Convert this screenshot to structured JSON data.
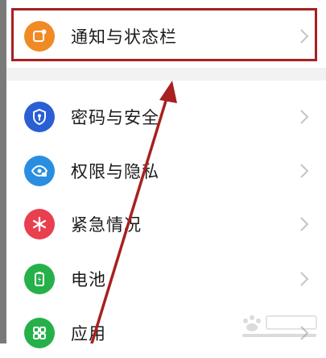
{
  "settings": {
    "items": [
      {
        "label": "通知与状态栏",
        "icon": "notification-icon",
        "icon_color": "#f08a24"
      },
      {
        "label": "密码与安全",
        "icon": "shield-key-icon",
        "icon_color": "#2a5fd6"
      },
      {
        "label": "权限与隐私",
        "icon": "eye-lock-icon",
        "icon_color": "#2a8ee0"
      },
      {
        "label": "紧急情况",
        "icon": "emergency-icon",
        "icon_color": "#e8404f"
      },
      {
        "label": "电池",
        "icon": "battery-icon",
        "icon_color": "#26b04a"
      },
      {
        "label": "应用",
        "icon": "apps-grid-icon",
        "icon_color": "#26b04a"
      }
    ]
  },
  "annotation": {
    "color": "#a82020"
  },
  "colors": {
    "separator": "#f2f2f2",
    "chevron": "#c4c4c4",
    "text": "#1b1b1b"
  }
}
